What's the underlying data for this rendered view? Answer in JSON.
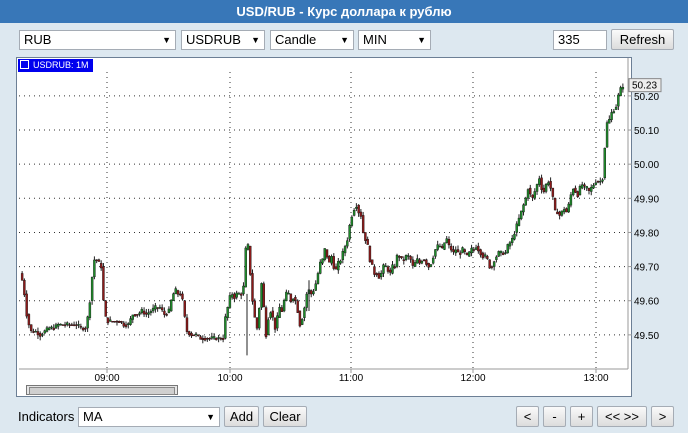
{
  "title": "USD/RUB - Курс доллара к рублю",
  "toolbar": {
    "market": "RUB",
    "symbol": "USDRUB",
    "chart_type": "Candle",
    "period": "MIN",
    "bars_count": "335",
    "refresh_label": "Refresh"
  },
  "legend_label": "USDRUB: 1M",
  "footer": {
    "indicators_label": "Indicators",
    "indicator_value": "MA",
    "add_label": "Add",
    "clear_label": "Clear",
    "nav": [
      "<",
      "-",
      "+",
      "<< >>",
      ">"
    ]
  },
  "colors": {
    "up": "#1e8a2a",
    "down": "#8b1a1a",
    "title_bg": "#3877b8",
    "legend_bg": "#0000ee"
  },
  "chart_data": {
    "type": "candlestick",
    "title": "",
    "xlabel": "",
    "ylabel": "",
    "x_ticks": [
      "09:00",
      "10:00",
      "11:00",
      "12:00",
      "13:00"
    ],
    "y_ticks": [
      49.5,
      49.6,
      49.7,
      49.8,
      49.9,
      50.0,
      50.1,
      50.2
    ],
    "ylim": [
      49.4,
      50.27
    ],
    "last_price": "50.23",
    "grid": true,
    "series_close": [
      [
        0,
        49.68
      ],
      [
        2,
        49.66
      ],
      [
        4,
        49.62
      ],
      [
        6,
        49.56
      ],
      [
        8,
        49.53
      ],
      [
        10,
        49.51
      ],
      [
        14,
        49.51
      ],
      [
        18,
        49.5
      ],
      [
        22,
        49.51
      ],
      [
        26,
        49.52
      ],
      [
        30,
        49.52
      ],
      [
        34,
        49.53
      ],
      [
        38,
        49.53
      ],
      [
        42,
        49.53
      ],
      [
        46,
        49.53
      ],
      [
        50,
        49.53
      ],
      [
        54,
        49.52
      ],
      [
        58,
        49.52
      ],
      [
        60,
        49.55
      ],
      [
        62,
        49.6
      ],
      [
        64,
        49.67
      ],
      [
        66,
        49.72
      ],
      [
        68,
        49.72
      ],
      [
        70,
        49.71
      ],
      [
        72,
        49.7
      ],
      [
        74,
        49.6
      ],
      [
        76,
        49.55
      ],
      [
        78,
        49.54
      ],
      [
        80,
        49.54
      ],
      [
        84,
        49.54
      ],
      [
        88,
        49.54
      ],
      [
        92,
        49.53
      ],
      [
        96,
        49.53
      ],
      [
        100,
        49.56
      ],
      [
        104,
        49.56
      ],
      [
        108,
        49.57
      ],
      [
        112,
        49.56
      ],
      [
        116,
        49.57
      ],
      [
        120,
        49.58
      ],
      [
        124,
        49.58
      ],
      [
        128,
        49.56
      ],
      [
        132,
        49.57
      ],
      [
        134,
        49.6
      ],
      [
        136,
        49.62
      ],
      [
        138,
        49.63
      ],
      [
        140,
        49.62
      ],
      [
        142,
        49.62
      ],
      [
        144,
        49.6
      ],
      [
        146,
        49.55
      ],
      [
        148,
        49.51
      ],
      [
        152,
        49.5
      ],
      [
        156,
        49.5
      ],
      [
        160,
        49.49
      ],
      [
        164,
        49.49
      ],
      [
        168,
        49.49
      ],
      [
        172,
        49.49
      ],
      [
        176,
        49.49
      ],
      [
        180,
        49.49
      ],
      [
        182,
        49.55
      ],
      [
        184,
        49.58
      ],
      [
        186,
        49.61
      ],
      [
        188,
        49.62
      ],
      [
        190,
        49.61
      ],
      [
        192,
        49.62
      ],
      [
        194,
        49.62
      ],
      [
        196,
        49.62
      ],
      [
        198,
        49.64
      ],
      [
        200,
        49.75
      ],
      [
        202,
        49.76
      ],
      [
        204,
        49.68
      ],
      [
        206,
        49.6
      ],
      [
        208,
        49.55
      ],
      [
        210,
        49.52
      ],
      [
        212,
        49.58
      ],
      [
        214,
        49.65
      ],
      [
        216,
        49.58
      ],
      [
        218,
        49.5
      ],
      [
        220,
        49.55
      ],
      [
        222,
        49.57
      ],
      [
        224,
        49.55
      ],
      [
        226,
        49.52
      ],
      [
        228,
        49.55
      ],
      [
        230,
        49.58
      ],
      [
        232,
        49.57
      ],
      [
        234,
        49.6
      ],
      [
        236,
        49.62
      ],
      [
        238,
        49.62
      ],
      [
        240,
        49.6
      ],
      [
        242,
        49.61
      ],
      [
        244,
        49.6
      ],
      [
        246,
        49.57
      ],
      [
        248,
        49.53
      ],
      [
        250,
        49.55
      ],
      [
        252,
        49.58
      ],
      [
        254,
        49.62
      ],
      [
        256,
        49.63
      ],
      [
        258,
        49.62
      ],
      [
        260,
        49.63
      ],
      [
        262,
        49.65
      ],
      [
        264,
        49.68
      ],
      [
        266,
        49.71
      ],
      [
        268,
        49.72
      ],
      [
        270,
        49.75
      ],
      [
        272,
        49.73
      ],
      [
        274,
        49.71
      ],
      [
        276,
        49.73
      ],
      [
        278,
        49.7
      ],
      [
        280,
        49.69
      ],
      [
        282,
        49.71
      ],
      [
        284,
        49.72
      ],
      [
        286,
        49.74
      ],
      [
        288,
        49.76
      ],
      [
        290,
        49.78
      ],
      [
        292,
        49.82
      ],
      [
        294,
        49.85
      ],
      [
        296,
        49.87
      ],
      [
        298,
        49.88
      ],
      [
        300,
        49.86
      ],
      [
        302,
        49.85
      ],
      [
        304,
        49.8
      ],
      [
        306,
        49.78
      ],
      [
        308,
        49.76
      ],
      [
        310,
        49.72
      ],
      [
        312,
        49.7
      ],
      [
        314,
        49.68
      ],
      [
        316,
        49.68
      ],
      [
        318,
        49.67
      ],
      [
        320,
        49.68
      ],
      [
        322,
        49.7
      ],
      [
        324,
        49.7
      ],
      [
        326,
        49.69
      ],
      [
        328,
        49.68
      ],
      [
        330,
        49.7
      ],
      [
        332,
        49.7
      ],
      [
        334,
        49.73
      ],
      [
        336,
        49.73
      ],
      [
        338,
        49.72
      ],
      [
        340,
        49.72
      ],
      [
        342,
        49.73
      ],
      [
        344,
        49.73
      ],
      [
        346,
        49.72
      ],
      [
        348,
        49.7
      ],
      [
        350,
        49.71
      ],
      [
        352,
        49.72
      ],
      [
        354,
        49.71
      ],
      [
        356,
        49.72
      ],
      [
        358,
        49.72
      ],
      [
        360,
        49.71
      ],
      [
        362,
        49.7
      ],
      [
        364,
        49.71
      ],
      [
        366,
        49.73
      ],
      [
        368,
        49.75
      ],
      [
        370,
        49.76
      ],
      [
        372,
        49.76
      ],
      [
        374,
        49.75
      ],
      [
        376,
        49.77
      ],
      [
        378,
        49.78
      ],
      [
        380,
        49.76
      ],
      [
        382,
        49.75
      ],
      [
        384,
        49.74
      ],
      [
        386,
        49.75
      ],
      [
        388,
        49.74
      ],
      [
        390,
        49.74
      ],
      [
        392,
        49.75
      ],
      [
        394,
        49.74
      ],
      [
        396,
        49.73
      ],
      [
        398,
        49.74
      ],
      [
        400,
        49.75
      ],
      [
        402,
        49.75
      ],
      [
        404,
        49.76
      ],
      [
        406,
        49.75
      ],
      [
        408,
        49.74
      ],
      [
        410,
        49.73
      ],
      [
        412,
        49.73
      ],
      [
        414,
        49.72
      ],
      [
        416,
        49.7
      ],
      [
        418,
        49.7
      ],
      [
        420,
        49.72
      ],
      [
        422,
        49.73
      ],
      [
        424,
        49.74
      ],
      [
        426,
        49.74
      ],
      [
        428,
        49.74
      ],
      [
        430,
        49.74
      ],
      [
        432,
        49.76
      ],
      [
        434,
        49.77
      ],
      [
        436,
        49.78
      ],
      [
        438,
        49.8
      ],
      [
        440,
        49.82
      ],
      [
        442,
        49.84
      ],
      [
        444,
        49.86
      ],
      [
        446,
        49.88
      ],
      [
        448,
        49.9
      ],
      [
        450,
        49.93
      ],
      [
        452,
        49.91
      ],
      [
        454,
        49.9
      ],
      [
        456,
        49.92
      ],
      [
        458,
        49.94
      ],
      [
        460,
        49.96
      ],
      [
        462,
        49.93
      ],
      [
        464,
        49.92
      ],
      [
        466,
        49.94
      ],
      [
        468,
        49.95
      ],
      [
        470,
        49.93
      ],
      [
        472,
        49.9
      ],
      [
        474,
        49.86
      ],
      [
        476,
        49.86
      ],
      [
        478,
        49.85
      ],
      [
        480,
        49.86
      ],
      [
        482,
        49.87
      ],
      [
        484,
        49.86
      ],
      [
        486,
        49.88
      ],
      [
        488,
        49.91
      ],
      [
        490,
        49.93
      ],
      [
        492,
        49.92
      ],
      [
        494,
        49.91
      ],
      [
        496,
        49.93
      ],
      [
        498,
        49.94
      ],
      [
        500,
        49.93
      ],
      [
        502,
        49.93
      ],
      [
        504,
        49.92
      ],
      [
        506,
        49.93
      ],
      [
        508,
        49.94
      ],
      [
        510,
        49.95
      ],
      [
        512,
        49.95
      ],
      [
        514,
        49.95
      ],
      [
        516,
        49.96
      ],
      [
        518,
        50.05
      ],
      [
        520,
        50.12
      ],
      [
        522,
        50.13
      ],
      [
        524,
        50.15
      ],
      [
        526,
        50.16
      ],
      [
        528,
        50.17
      ],
      [
        530,
        50.2
      ],
      [
        532,
        50.22
      ],
      [
        534,
        50.23
      ]
    ]
  }
}
